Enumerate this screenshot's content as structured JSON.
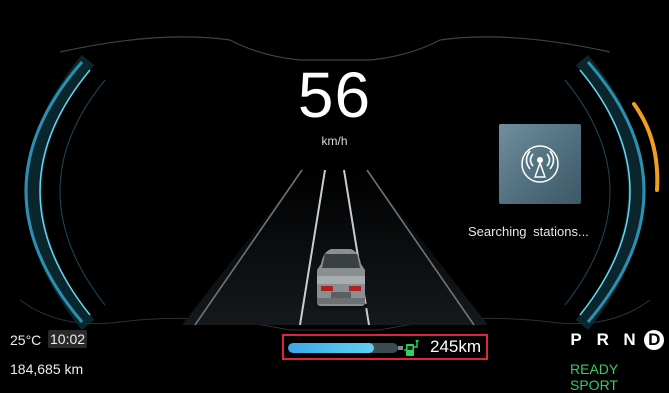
{
  "speed": {
    "value": "56",
    "unit": "km/h"
  },
  "radio": {
    "icon": "radio-broadcast-icon",
    "status": "Searching  stations..."
  },
  "environment": {
    "temperature": "25°C",
    "time": "10:02"
  },
  "odometer": "184,685 km",
  "battery": {
    "level_fraction": 0.78,
    "range": "245km",
    "icon": "charging-plug-icon"
  },
  "gears": {
    "items": [
      "P",
      "R",
      "N",
      "D"
    ],
    "selected": "D"
  },
  "drive_status": {
    "ready": "READY",
    "mode": "SPORT"
  },
  "colors": {
    "accent": "#4fd3f0",
    "ready": "#2fcf63",
    "warning_arc": "#f0a020",
    "highlight_box": "#e0243a"
  }
}
